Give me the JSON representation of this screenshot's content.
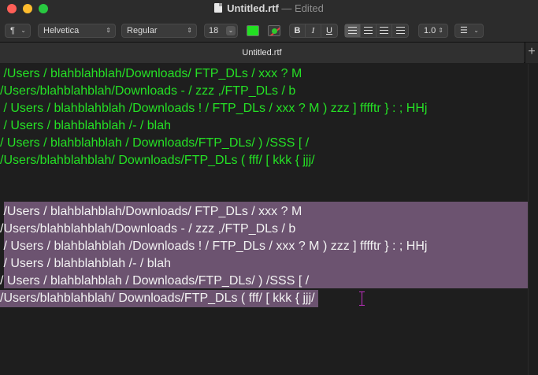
{
  "window": {
    "title": "Untitled.rtf",
    "title_separator": " — ",
    "status": "Edited"
  },
  "toolbar": {
    "paragraph_style": "¶",
    "font_family": "Helvetica",
    "font_style": "Regular",
    "font_size": "18",
    "text_color": "#22e022",
    "bold": "B",
    "italic": "I",
    "underline": "U",
    "line_spacing": "1.0",
    "list_icon": "list-bullets-icon"
  },
  "tabs": [
    {
      "label": "Untitled.rtf"
    }
  ],
  "tab_add": "+",
  "document": {
    "green_lines": [
      " /Users / blahblahblah/Downloads/ FTP_DLs / xxx ? M",
      "/Users/blahblahblah/Downloads - / zzz ,/FTP_DLs / b",
      " / Users / blahblahblah /Downloads ! / FTP_DLs / xxx ? M ) zzz ] fffftr } : ; HHj",
      " / Users / blahblahblah /- / blah",
      "/ Users / blahblahblah / Downloads/FTP_DLs/ ) /SSS [ /",
      "/Users/blahblahblah/ Downloads/FTP_DLs ( fff/ [ kkk { jjj/"
    ],
    "selected_lines": [
      " /Users / blahblahblah/Downloads/ FTP_DLs / xxx ? M",
      "/Users/blahblahblah/Downloads - / zzz ,/FTP_DLs / b",
      " / Users / blahblahblah /Downloads ! / FTP_DLs / xxx ? M ) zzz ] fffftr } : ; HHj",
      " / Users / blahblahblah /- / blah",
      "/ Users / blahblahblah / Downloads/FTP_DLs/ ) /SSS [ /",
      "/Users/blahblahblah/ Downloads/FTP_DLs ( fff/ [ kkk { jjj/"
    ],
    "selection_color": "#6c5370",
    "green_text_color": "#25e025"
  }
}
